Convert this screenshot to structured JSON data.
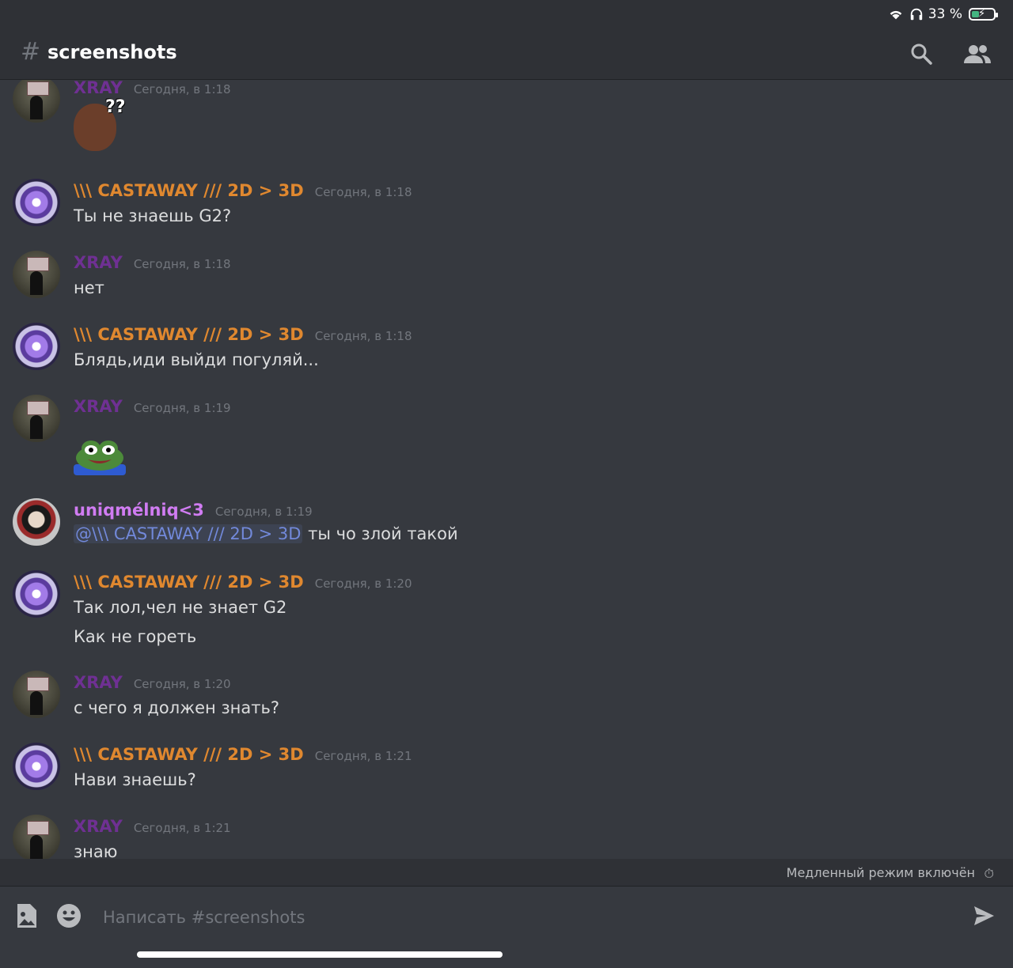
{
  "status": {
    "battery_percent": "33 %",
    "battery_level": 0.33
  },
  "header": {
    "hash": "#",
    "channel": "screenshots"
  },
  "messages": [
    {
      "author": "XRAY",
      "time": "Сегодня, в 1:18",
      "emoji": "??"
    },
    {
      "author": "\\\\\\ CASTAWAY ///  2D > 3D",
      "time": "Сегодня, в 1:18",
      "text": "Ты не знаешь G2?"
    },
    {
      "author": "XRAY",
      "time": "Сегодня, в 1:18",
      "text": "нет"
    },
    {
      "author": "\\\\\\ CASTAWAY ///  2D > 3D",
      "time": "Сегодня, в 1:18",
      "text": "Блядь,иди выйди погуляй..."
    },
    {
      "author": "XRAY",
      "time": "Сегодня, в 1:19"
    },
    {
      "author": "uniqmélniq<3",
      "time": "Сегодня, в 1:19",
      "mention": "@\\\\\\ CASTAWAY ///  2D > 3D",
      "text": "ты чо злой такой"
    },
    {
      "author": "\\\\\\ CASTAWAY ///  2D > 3D",
      "time": "Сегодня, в 1:20",
      "text": "Так лол,чел не знает G2",
      "text2": "Как не гореть"
    },
    {
      "author": "XRAY",
      "time": "Сегодня, в 1:20",
      "text": "с чего я должен знать?"
    },
    {
      "author": "\\\\\\ CASTAWAY ///  2D > 3D",
      "time": "Сегодня, в 1:21",
      "text": "Нави знаешь?"
    },
    {
      "author": "XRAY",
      "time": "Сегодня, в 1:21",
      "text": "знаю"
    }
  ],
  "slow_mode": {
    "label": "Медленный режим включён"
  },
  "composer": {
    "placeholder": "Написать #screenshots"
  }
}
